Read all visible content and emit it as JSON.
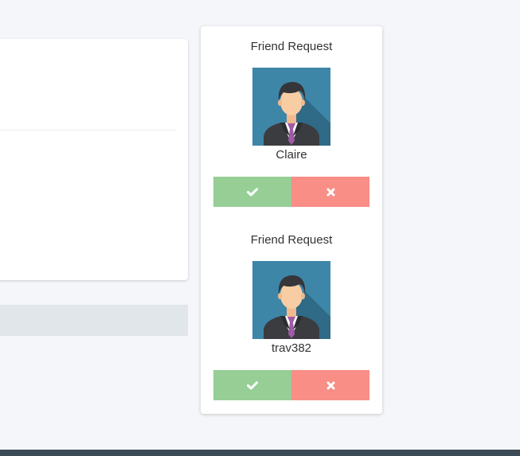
{
  "friend_requests": [
    {
      "title": "Friend Request",
      "name": "Claire",
      "avatar_icon": "user-avatar-icon",
      "accept_icon": "check-icon",
      "decline_icon": "x-icon"
    },
    {
      "title": "Friend Request",
      "name": "trav382",
      "avatar_icon": "user-avatar-icon",
      "accept_icon": "check-icon",
      "decline_icon": "x-icon"
    }
  ],
  "colors": {
    "page_background": "#f4f6f9",
    "accept": "#96ce96",
    "decline": "#f88e86",
    "footer": "#3c4a56",
    "avatar_background": "#3e86a8"
  }
}
